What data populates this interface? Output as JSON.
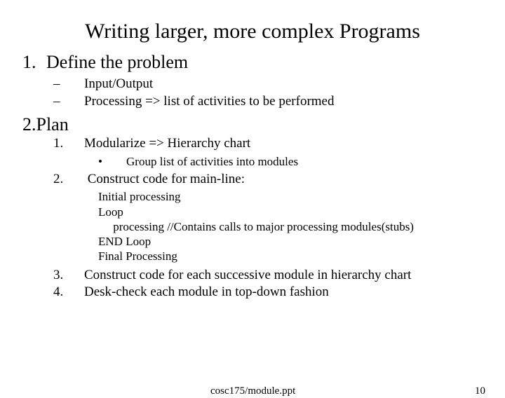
{
  "title": "Writing larger, more complex Programs",
  "s1": {
    "num": "1.",
    "text": "Define the problem"
  },
  "s1a": {
    "dash": "–",
    "text": "Input/Output"
  },
  "s1b": {
    "dash": "–",
    "text": "Processing => list of activities to be performed"
  },
  "s2": {
    "num": "2.",
    "text": "Plan"
  },
  "p1": {
    "num": "1.",
    "text": "Modularize  => Hierarchy chart"
  },
  "p1a": {
    "b": "•",
    "text": "Group list of activities into modules"
  },
  "p2": {
    "num": "2.",
    "text": " Construct code for main-line:"
  },
  "code": "Initial processing\nLoop\n     processing //Contains calls to major processing modules(stubs)\nEND Loop\nFinal Processing",
  "p3": {
    "num": "3.",
    "text": "Construct code for each successive module in hierarchy chart"
  },
  "p4": {
    "num": "4.",
    "text": "Desk-check each module in top-down fashion"
  },
  "footer": {
    "path": "cosc175/module.ppt",
    "page": "10"
  }
}
